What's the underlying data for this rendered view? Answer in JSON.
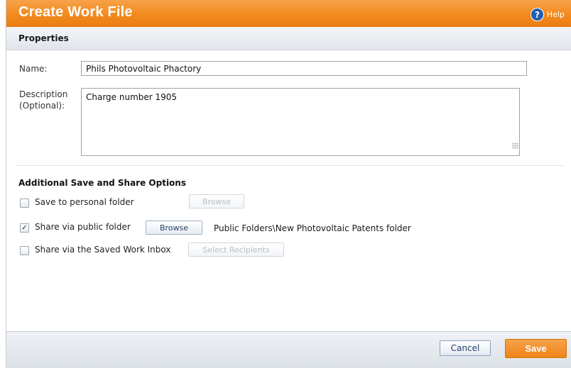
{
  "dialog": {
    "title": "Create Work File",
    "help_label": "Help",
    "help_icon": "question-circle-icon",
    "accent_color": "#f28a1e",
    "help_icon_color": "#1e5fb4"
  },
  "properties": {
    "heading": "Properties",
    "name_label": "Name:",
    "name_value": "Phils Photovoltaic Phactory",
    "description_label_line1": "Description",
    "description_label_line2": "(Optional):",
    "description_value": "Charge number 1905"
  },
  "share_options": {
    "heading": "Additional Save and Share Options",
    "personal_folder": {
      "label": "Save to personal folder",
      "checked": false,
      "button_label": "Browse",
      "button_enabled": false
    },
    "public_folder": {
      "label": "Share via public folder",
      "checked": true,
      "button_label": "Browse",
      "button_enabled": true,
      "selected_path": "Public Folders\\New Photovoltaic Patents folder"
    },
    "saved_work_inbox": {
      "label": "Share via the Saved Work Inbox",
      "checked": false,
      "button_label": "Select Recipients",
      "button_enabled": false
    }
  },
  "footer": {
    "cancel_label": "Cancel",
    "save_label": "Save"
  }
}
